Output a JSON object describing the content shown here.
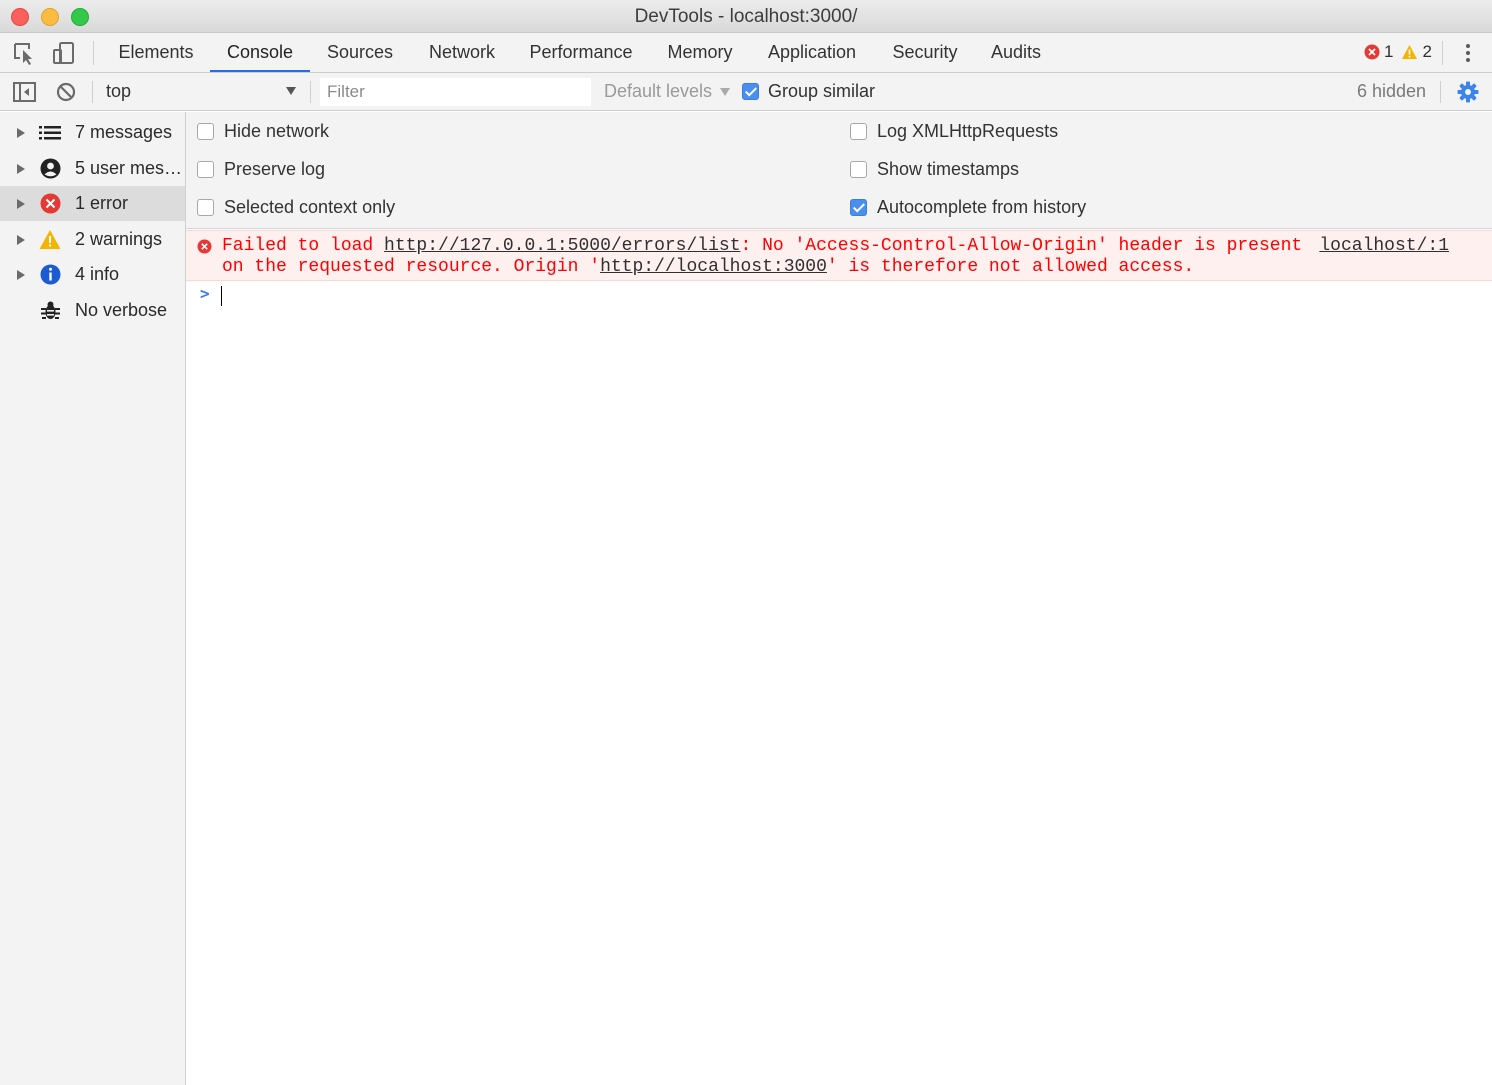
{
  "window": {
    "title": "DevTools - localhost:3000/"
  },
  "tabs": [
    "Elements",
    "Console",
    "Sources",
    "Network",
    "Performance",
    "Memory",
    "Application",
    "Security",
    "Audits"
  ],
  "active_tab": "Console",
  "counts": {
    "errors": "1",
    "warnings": "2"
  },
  "toolbar": {
    "context": "top",
    "filter_placeholder": "Filter",
    "default_levels": "Default levels",
    "group_similar": "Group similar",
    "group_similar_checked": true,
    "hidden": "6 hidden"
  },
  "sidebar": {
    "items": [
      {
        "label": "7 messages",
        "icon": "list-icon"
      },
      {
        "label": "5 user mes…",
        "icon": "user-icon"
      },
      {
        "label": "1 error",
        "icon": "error-icon",
        "selected": true
      },
      {
        "label": "2 warnings",
        "icon": "warning-icon"
      },
      {
        "label": "4 info",
        "icon": "info-icon"
      },
      {
        "label": "No verbose",
        "icon": "bug-icon"
      }
    ]
  },
  "settings": {
    "hide_network": "Hide network",
    "preserve_log": "Preserve log",
    "selected_context_only": "Selected context only",
    "log_xhr": "Log XMLHttpRequests",
    "show_timestamps": "Show timestamps",
    "autocomplete_history": "Autocomplete from history",
    "autocomplete_checked": true
  },
  "console": {
    "error": {
      "prefix": "Failed to load ",
      "url": "http://127.0.0.1:5000/errors/list",
      "middle": ": No 'Access-Control-Allow-Origin' header is present",
      "line2_prefix": "on the requested resource. Origin '",
      "origin": "http://localhost:3000",
      "line2_suffix": "' is therefore not allowed access.",
      "source": "localhost/:1"
    },
    "prompt": ">"
  },
  "colors": {
    "accent": "#1a73e8",
    "error": "#ff0000",
    "error_bg": "#fff0f0",
    "warning": "#f4b400",
    "info": "#1b5bd4"
  }
}
